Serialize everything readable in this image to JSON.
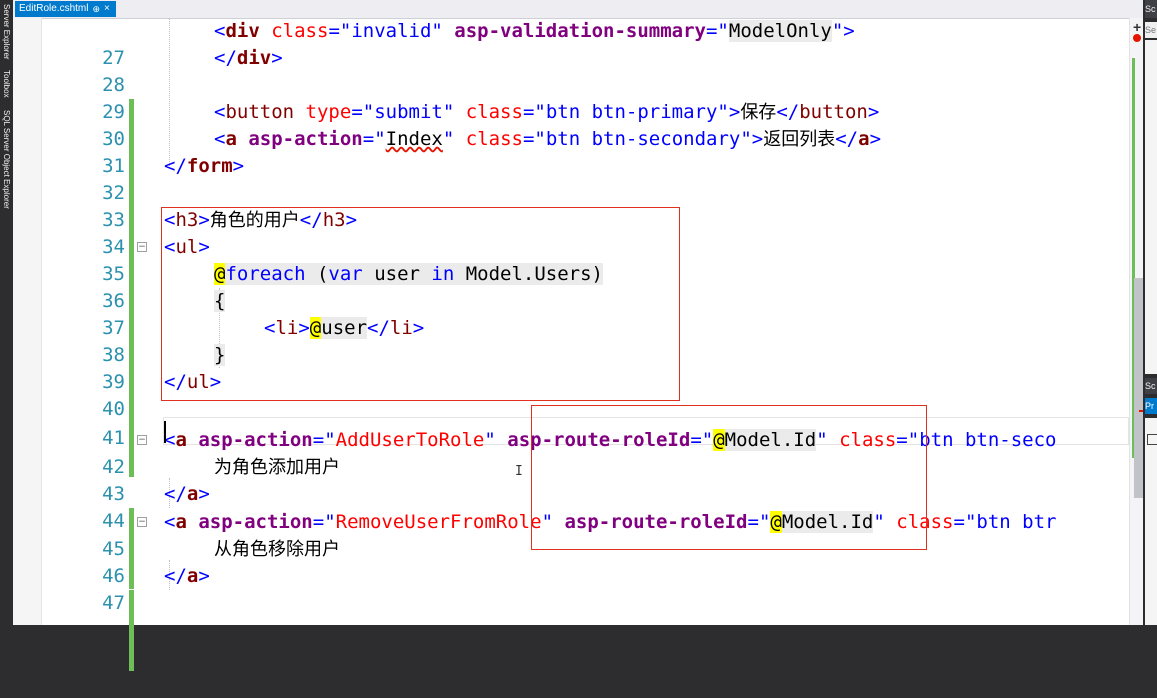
{
  "tool_windows": [
    "Server Explorer",
    "Toolbox",
    "SQL Server Object Explorer"
  ],
  "editor": {
    "tab_title": "EditRole.cshtml",
    "tab_pin_glyph": "⊕",
    "tab_close_glyph": "×"
  },
  "right_panel": {
    "header": "Sc",
    "search_placeholder": "Se",
    "header2": "Sc",
    "tab": "Pr"
  },
  "code_lines": [
    {
      "n": "27",
      "text": "<div class=\"invalid\" asp-validation-summary=\"ModelOnly\">"
    },
    {
      "n": "28",
      "text": "</div>"
    },
    {
      "n": "29",
      "text": ""
    },
    {
      "n": "30",
      "text": "<button type=\"submit\" class=\"btn btn-primary\">保存</button>"
    },
    {
      "n": "31",
      "text": "<a asp-action=\"Index\" class=\"btn btn-secondary\">返回列表</a>"
    },
    {
      "n": "32",
      "text": "</form>"
    },
    {
      "n": "33",
      "text": ""
    },
    {
      "n": "34",
      "text": "<h3>角色的用户</h3>"
    },
    {
      "n": "35",
      "text": "<ul>"
    },
    {
      "n": "36",
      "text": "@foreach (var user in Model.Users)"
    },
    {
      "n": "37",
      "text": "{"
    },
    {
      "n": "38",
      "text": "<li>@user</li>"
    },
    {
      "n": "39",
      "text": "}"
    },
    {
      "n": "40",
      "text": "</ul>"
    },
    {
      "n": "41",
      "text": ""
    },
    {
      "n": "42",
      "text": "<a asp-action=\"AddUserToRole\" asp-route-roleId=\"@Model.Id\" class=\"btn btn-seco"
    },
    {
      "n": "43",
      "text": "为角色添加用户"
    },
    {
      "n": "44",
      "text": "</a>"
    },
    {
      "n": "45",
      "text": "<a asp-action=\"RemoveUserFromRole\" asp-route-roleId=\"@Model.Id\" class=\"btn btr"
    },
    {
      "n": "46",
      "text": "从角色移除用户"
    },
    {
      "n": "47",
      "text": "</a>"
    }
  ],
  "icons": {
    "fold": "⊟",
    "ibeam": "I",
    "scroll_plus": "+"
  },
  "colors": {
    "line_number": "#2b91af",
    "tag": "#800000",
    "attribute": "#ff0000",
    "tag_helper_attribute": "#800080",
    "value": "#0000ff",
    "razor_highlight": "#ffff00",
    "change_bar": "#6dbd58",
    "annotation_box": "#e0311f",
    "active_tab": "#007acc"
  }
}
